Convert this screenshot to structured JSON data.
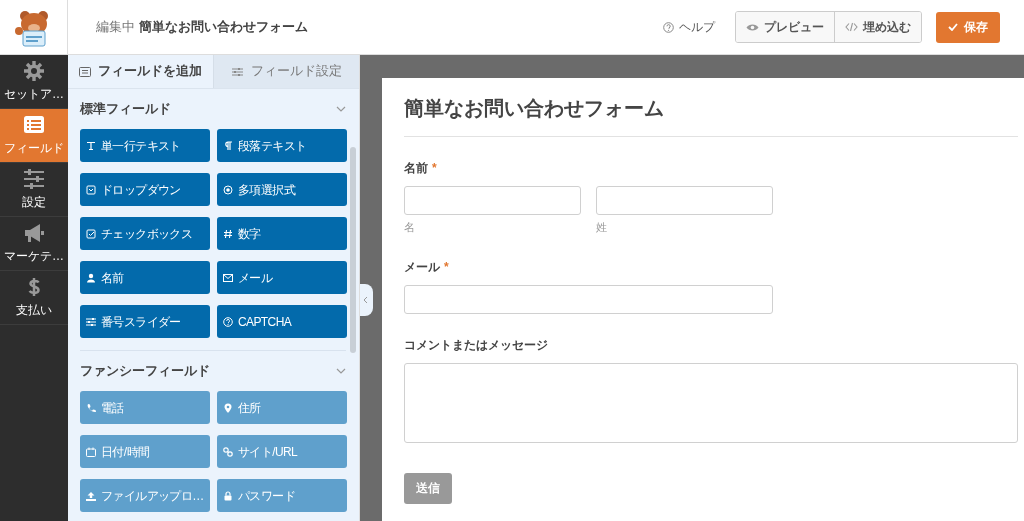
{
  "header": {
    "editing_label": "編集中",
    "form_name": "簡単なお問い合わせフォーム",
    "help": "ヘルプ",
    "preview": "プレビュー",
    "embed": "埋め込む",
    "save": "保存"
  },
  "sidebar": {
    "items": [
      {
        "label": "セットア…",
        "selected": false
      },
      {
        "label": "フィールド",
        "selected": true
      },
      {
        "label": "設定",
        "selected": false
      },
      {
        "label": "マーケテ…",
        "selected": false
      },
      {
        "label": "支払い",
        "selected": false
      }
    ]
  },
  "panel": {
    "tabs": [
      {
        "label": "フィールドを追加",
        "selected": true
      },
      {
        "label": "フィールド設定",
        "selected": false
      }
    ],
    "sections": [
      {
        "title": "標準フィールド",
        "expanded": true,
        "kind": "standard",
        "fields": [
          "単一行テキスト",
          "段落テキスト",
          "ドロップダウン",
          "多項選択式",
          "チェックボックス",
          "数字",
          "名前",
          "メール",
          "番号スライダー",
          "CAPTCHA"
        ]
      },
      {
        "title": "ファンシーフィールド",
        "expanded": true,
        "kind": "fancy",
        "fields": [
          "電話",
          "住所",
          "日付/時間",
          "サイト/URL",
          "ファイルアップロ…",
          "パスワード"
        ]
      }
    ]
  },
  "form": {
    "title": "簡単なお問い合わせフォーム",
    "fields": [
      {
        "kind": "name",
        "label": "名前",
        "required_mark": "*",
        "sublabels": [
          "名",
          "姓"
        ]
      },
      {
        "kind": "email",
        "label": "メール",
        "required_mark": "*"
      },
      {
        "kind": "textarea",
        "label": "コメントまたはメッセージ"
      }
    ],
    "submit": "送信"
  }
}
